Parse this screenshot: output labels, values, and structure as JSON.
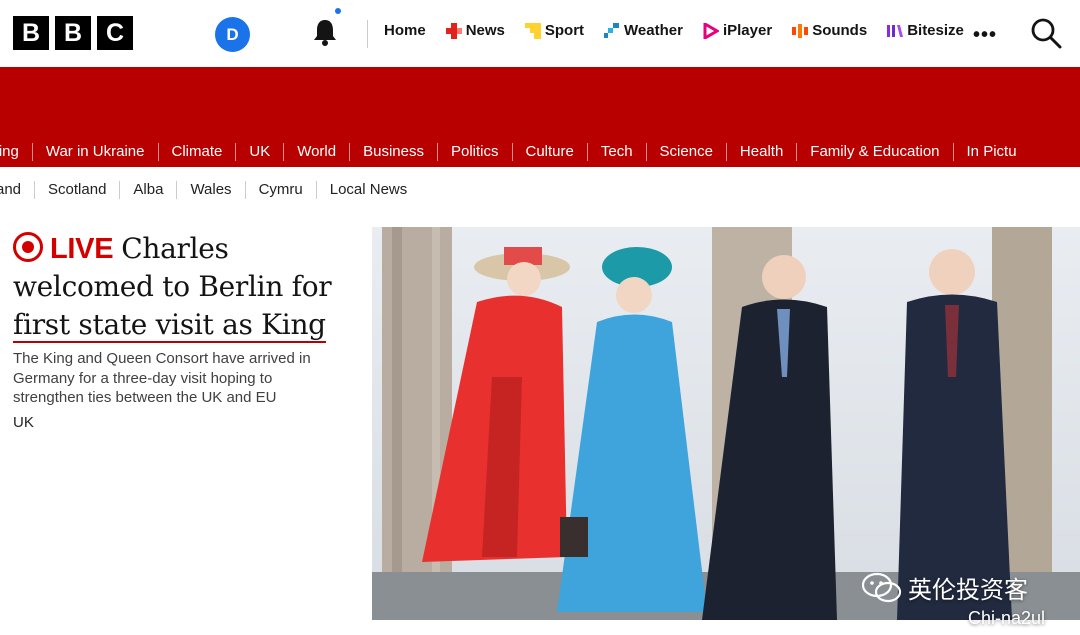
{
  "header": {
    "logo_letters": [
      "B",
      "B",
      "C"
    ],
    "avatar_initial": "D",
    "nav": [
      {
        "label": "Home",
        "icon": "none"
      },
      {
        "label": "News",
        "icon": "news-icon",
        "color": "#e2231a"
      },
      {
        "label": "Sport",
        "icon": "sport-icon",
        "color": "#ffd230"
      },
      {
        "label": "Weather",
        "icon": "weather-icon",
        "color": "#1d85c6"
      },
      {
        "label": "iPlayer",
        "icon": "iplayer-icon",
        "color": "#e6007e"
      },
      {
        "label": "Sounds",
        "icon": "sounds-icon",
        "color": "#ff4800"
      },
      {
        "label": "Bitesize",
        "icon": "bitesize-icon",
        "color": "#8a2be2"
      }
    ],
    "more_label": "•••"
  },
  "subnav": [
    "iving",
    "War in Ukraine",
    "Climate",
    "UK",
    "World",
    "Business",
    "Politics",
    "Culture",
    "Tech",
    "Science",
    "Health",
    "Family & Education",
    "In Pictu"
  ],
  "regions": [
    "and",
    "Scotland",
    "Alba",
    "Wales",
    "Cymru",
    "Local News"
  ],
  "story": {
    "live_label": "LIVE",
    "headline_line1": "Charles",
    "headline_line2": "welcomed to Berlin for",
    "headline_line3": "first state visit as King",
    "summary": "The King and Queen Consort have arrived in Germany for a three-day visit hoping to strengthen ties between the UK and EU",
    "tag": "UK"
  },
  "watermark": {
    "text": "英伦投资客",
    "sub": "Chi-na2ul"
  },
  "colors": {
    "brand_red": "#b80000",
    "live_red": "#d40000",
    "avatar_blue": "#1a73e8"
  }
}
